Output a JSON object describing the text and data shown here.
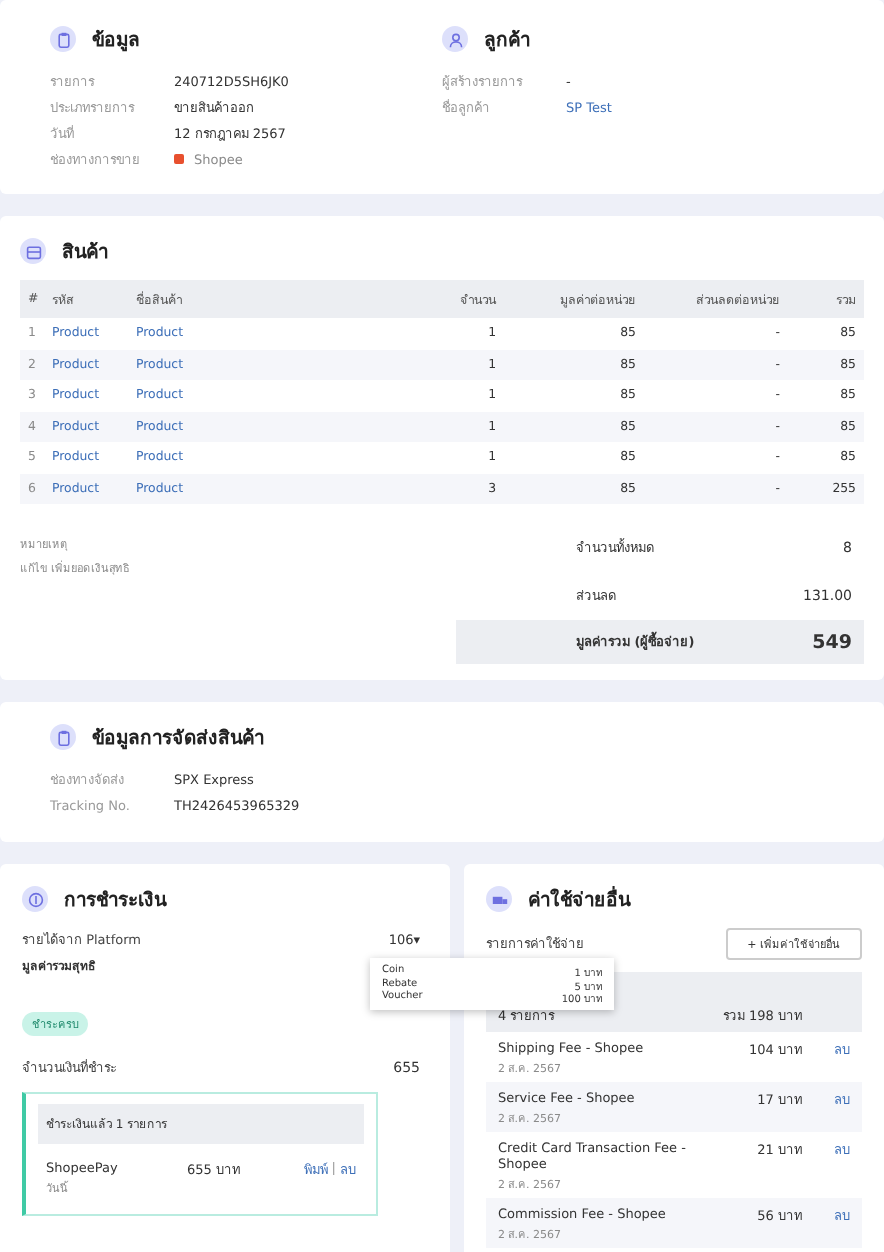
{
  "info": {
    "title": "ข้อมูล",
    "rows": [
      {
        "kind": "text",
        "label": "รายการ",
        "value": "240712D5SH6JK0"
      },
      {
        "kind": "text",
        "label": "ประเภทรายการ",
        "value": "ขายสินค้าออก"
      },
      {
        "kind": "text",
        "label": "วันที่",
        "value": "12 กรกฎาคม 2567"
      },
      {
        "kind": "channel",
        "label": "ช่องทางการขาย",
        "value": "Shopee"
      }
    ]
  },
  "customer": {
    "title": "ลูกค้า",
    "rows": [
      {
        "kind": "text",
        "label": "ผู้สร้างรายการ",
        "value": "-"
      },
      {
        "kind": "link",
        "label": "ชื่อลูกค้า",
        "value": "SP Test"
      }
    ]
  },
  "products": {
    "title": "สินค้า",
    "columns": [
      "#",
      "รหัส",
      "ชื่อสินค้า",
      "จำนวน",
      "มูลค่าต่อหน่วย",
      "ส่วนลดต่อหน่วย",
      "รวม"
    ],
    "rows": [
      {
        "no": "1",
        "code": "Product",
        "name": "Product",
        "qty": "1",
        "unit_price": "85",
        "discount": "-",
        "total": "85"
      },
      {
        "no": "2",
        "code": "Product",
        "name": "Product",
        "qty": "1",
        "unit_price": "85",
        "discount": "-",
        "total": "85"
      },
      {
        "no": "3",
        "code": "Product",
        "name": "Product",
        "qty": "1",
        "unit_price": "85",
        "discount": "-",
        "total": "85"
      },
      {
        "no": "4",
        "code": "Product",
        "name": "Product",
        "qty": "1",
        "unit_price": "85",
        "discount": "-",
        "total": "85"
      },
      {
        "no": "5",
        "code": "Product",
        "name": "Product",
        "qty": "1",
        "unit_price": "85",
        "discount": "-",
        "total": "85"
      },
      {
        "no": "6",
        "code": "Product",
        "name": "Product",
        "qty": "3",
        "unit_price": "85",
        "discount": "-",
        "total": "255"
      }
    ]
  },
  "summary": {
    "note_label": "หมายเหตุ",
    "note_text": "แก้ไข เพิ่มยอดเงินสุทธิ",
    "rows": [
      {
        "label": "จำนวนทั้งหมด",
        "value": "8"
      },
      {
        "label": "ส่วนลด",
        "value": "131.00"
      }
    ],
    "grand_total": {
      "label": "มูลค่ารวม (ผู้ซื้อจ่าย)",
      "value": "549"
    }
  },
  "shipping": {
    "title": "ข้อมูลการจัดส่งสินค้า",
    "rows": [
      {
        "label": "ช่องทางจัดส่ง",
        "value": "SPX Express"
      },
      {
        "label": "Tracking No.",
        "value": "TH2426453965329"
      }
    ]
  },
  "payment": {
    "title": "การชำระเงิน",
    "platform_income": {
      "label": "รายได้จาก Platform",
      "value": "106▾"
    },
    "net_total_label": "มูลค่ารวมสุทธิ",
    "breakdown": [
      {
        "name": "Coin",
        "amount": "1 บาท"
      },
      {
        "name": "Rebate",
        "amount": "5 บาท"
      },
      {
        "name": "Voucher",
        "amount": "100 บาท"
      }
    ],
    "status_badge": "ชำระครบ",
    "paid_amount": {
      "label": "จำนวนเงินที่ชำระ",
      "value": "655"
    },
    "paid_box": {
      "header": "ชำระเงินแล้ว 1 รายการ",
      "items": [
        {
          "method": "ShopeePay",
          "date": "วันนี้",
          "amount": "655 บาท",
          "actions": [
            "พิมพ์",
            "ลบ"
          ],
          "action_separator": "|"
        }
      ]
    }
  },
  "expenses": {
    "title": "ค่าใช้จ่ายอื่น",
    "list_label": "รายการค่าใช้จ่าย",
    "add_button": "+ เพิ่มค่าใช้จ่ายอื่น",
    "header": {
      "count": "4 รายการ",
      "total": "รวม 198 บาท"
    },
    "rows": [
      {
        "name": "Shipping Fee - Shopee",
        "date": "2 ส.ค. 2567",
        "amount": "104 บาท",
        "action": "ลบ"
      },
      {
        "name": "Service Fee - Shopee",
        "date": "2 ส.ค. 2567",
        "amount": "17 บาท",
        "action": "ลบ"
      },
      {
        "name": "Credit Card Transaction Fee - Shopee",
        "date": "2 ส.ค. 2567",
        "amount": "21 บาท",
        "action": "ลบ"
      },
      {
        "name": "Commission Fee - Shopee",
        "date": "2 ส.ค. 2567",
        "amount": "56 บาท",
        "action": "ลบ"
      }
    ]
  }
}
